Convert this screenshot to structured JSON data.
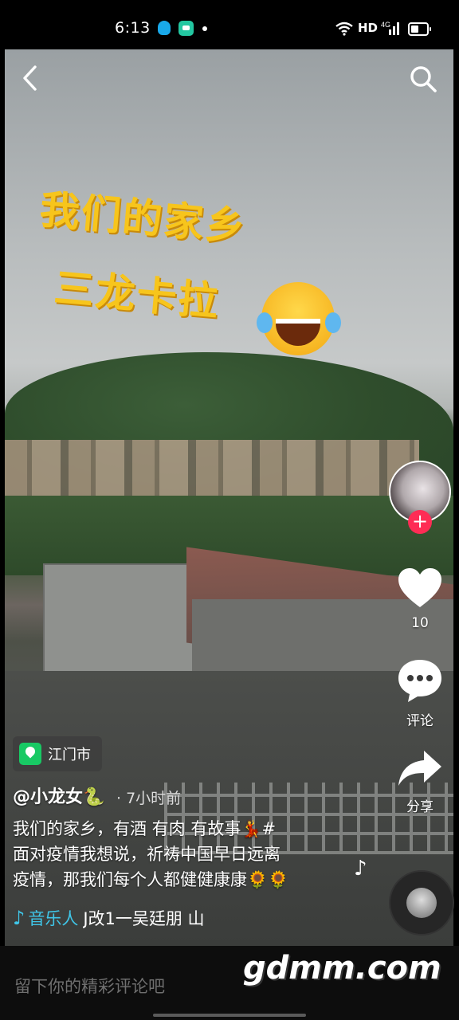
{
  "status_bar": {
    "time": "6:13",
    "network_label": "HD",
    "signal_label": "4G"
  },
  "video": {
    "overlay_line1": "我们的家乡",
    "overlay_line2": "三龙卡拉",
    "emoji_name": "laughing-tears-emoji"
  },
  "sidebar": {
    "like_count": "10",
    "comment_label": "评论",
    "share_label": "分享",
    "follow_symbol": "+"
  },
  "post": {
    "location": "江门市",
    "author": "@小龙女",
    "author_emoji": "🐍",
    "time_ago": "· 7小时前",
    "caption_lines": [
      "我们的家乡，有酒  有肉  有故事💃#",
      "面对疫情我想说，祈祷中国早日远离",
      "疫情，那我们每个人都健健康康🌻🌻"
    ],
    "music_source": "音乐人",
    "music_title": "J改1一吴廷朋   山"
  },
  "comment_bar": {
    "placeholder": "留下你的精彩评论吧"
  },
  "watermark": "gdmm.com",
  "colors": {
    "accent_red": "#fe2c55",
    "overlay_yellow": "#f7c51c",
    "music_blue": "#3fc6e8",
    "location_green": "#18c964"
  }
}
